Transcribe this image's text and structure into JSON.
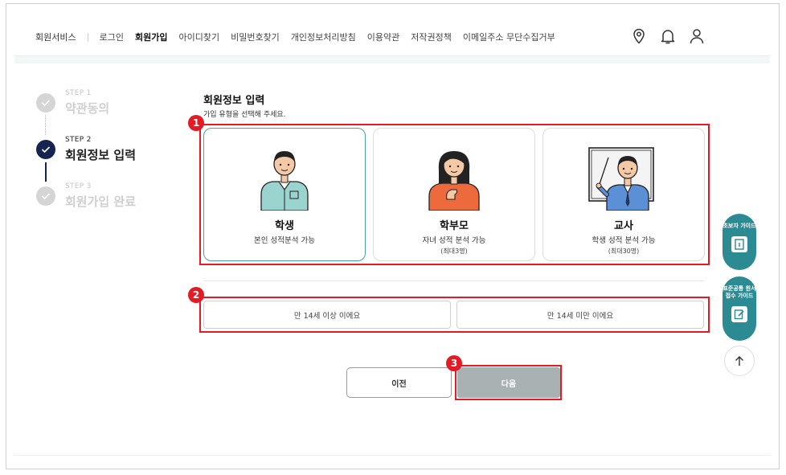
{
  "nav": {
    "brand": "회원서비스",
    "items": [
      {
        "label": "로그인",
        "active": false
      },
      {
        "label": "회원가입",
        "active": true
      },
      {
        "label": "아이디찾기",
        "active": false
      },
      {
        "label": "비밀번호찾기",
        "active": false
      },
      {
        "label": "개인정보처리방침",
        "active": false
      },
      {
        "label": "이용약관",
        "active": false
      },
      {
        "label": "저작권정책",
        "active": false
      },
      {
        "label": "이메일주소 무단수집거부",
        "active": false
      }
    ],
    "icons": [
      "location-pin-icon",
      "bell-icon",
      "user-icon"
    ]
  },
  "steps": [
    {
      "label": "STEP 1",
      "name": "약관동의",
      "state": "done"
    },
    {
      "label": "STEP 2",
      "name": "회원정보 입력",
      "state": "current"
    },
    {
      "label": "STEP 3",
      "name": "회원가입 완료",
      "state": "pending"
    }
  ],
  "main": {
    "title": "회원정보 입력",
    "subtitle": "가입 유형을 선택해 주세요.",
    "cards": [
      {
        "name": "학생",
        "desc": "본인 성적분석 가능",
        "note": "",
        "selected": true
      },
      {
        "name": "학부모",
        "desc": "자녀 성적 분석 가능",
        "note": "(최대3명)",
        "selected": false
      },
      {
        "name": "교사",
        "desc": "학생 성적 분석 가능",
        "note": "(최대30명)",
        "selected": false
      }
    ],
    "age_options": [
      "만 14세 이상 이에요",
      "만 14세 미만 이에요"
    ],
    "prev_label": "이전",
    "next_label": "다음"
  },
  "annotations": [
    "1",
    "2",
    "3"
  ],
  "side": {
    "guide1": "초보자 가이드",
    "guide2": "표준공통 원서접수 가이드"
  },
  "colors": {
    "accent": "#2c8a92",
    "step_active": "#14244f",
    "highlight": "#e21b24",
    "next_disabled": "#a9b1b2"
  }
}
